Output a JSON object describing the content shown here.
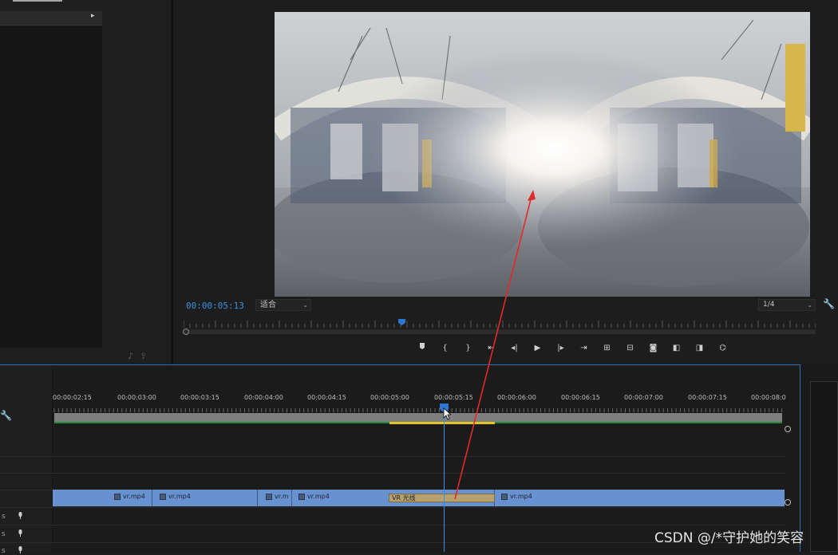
{
  "monitor": {
    "timecode": "00:00:05:13",
    "fit_label": "适合",
    "resolution_label": "1/4"
  },
  "timeline": {
    "ruler_labels": [
      "00:00:02:15",
      "00:00:03:00",
      "00:00:03:15",
      "00:00:04:00",
      "00:00:04:15",
      "00:00:05:00",
      "00:00:05:15",
      "00:00:06:00",
      "00:00:06:15",
      "00:00:07:00",
      "00:00:07:15",
      "00:00:08:0"
    ],
    "audio_track_prefix": "s",
    "clips": [
      {
        "name": "vr.mp4"
      },
      {
        "name": "vr.mp4"
      },
      {
        "name": "vr.m"
      },
      {
        "name": "vr.mp4"
      },
      {
        "name": "vr.mp4"
      }
    ],
    "effect_label": "VR 光线"
  },
  "watermark": "CSDN @/*守护她的笑容",
  "colors": {
    "accent_blue": "#3c8fe0",
    "clip_blue": "#6892cf",
    "effect_tan": "#b8a16f",
    "annotation_red": "#e02a2a",
    "inout_yellow": "#e0c428",
    "render_green": "#1f8a3a"
  }
}
